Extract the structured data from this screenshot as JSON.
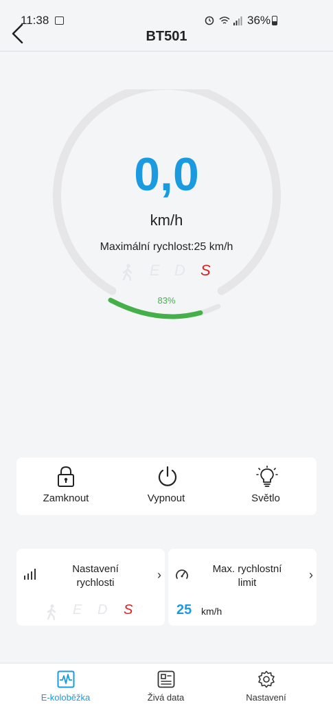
{
  "status": {
    "time": "11:38",
    "battery": "36%"
  },
  "header": {
    "title": "BT501"
  },
  "dashboard": {
    "speed": "0,0",
    "unit": "km/h",
    "max_speed_label": "Maximální rychlost:25 km/h",
    "battery_percent": "83%",
    "battery_level": 0.83,
    "modes": [
      "E",
      "D",
      "S"
    ],
    "active_mode": "S"
  },
  "actions": [
    {
      "label": "Zamknout",
      "icon": "lock-icon"
    },
    {
      "label": "Vypnout",
      "icon": "power-icon"
    },
    {
      "label": "Světlo",
      "icon": "bulb-icon"
    }
  ],
  "settings": {
    "speed_setting": {
      "title_line1": "Nastavení",
      "title_line2": "rychlosti",
      "icon": "signal-bars-icon"
    },
    "speed_limit": {
      "title_line1": "Max. rychlostní",
      "title_line2": "limit",
      "value": "25",
      "unit": "km/h",
      "icon": "speedometer-icon"
    }
  },
  "tabs": [
    {
      "label": "E-koloběžka",
      "icon": "activity-icon",
      "active": true
    },
    {
      "label": "Živá data",
      "icon": "data-icon",
      "active": false
    },
    {
      "label": "Nastavení",
      "icon": "gear-icon",
      "active": false
    }
  ],
  "colors": {
    "accent": "#1a9be0",
    "battery": "#45b04a",
    "sport_mode": "#e02020"
  }
}
